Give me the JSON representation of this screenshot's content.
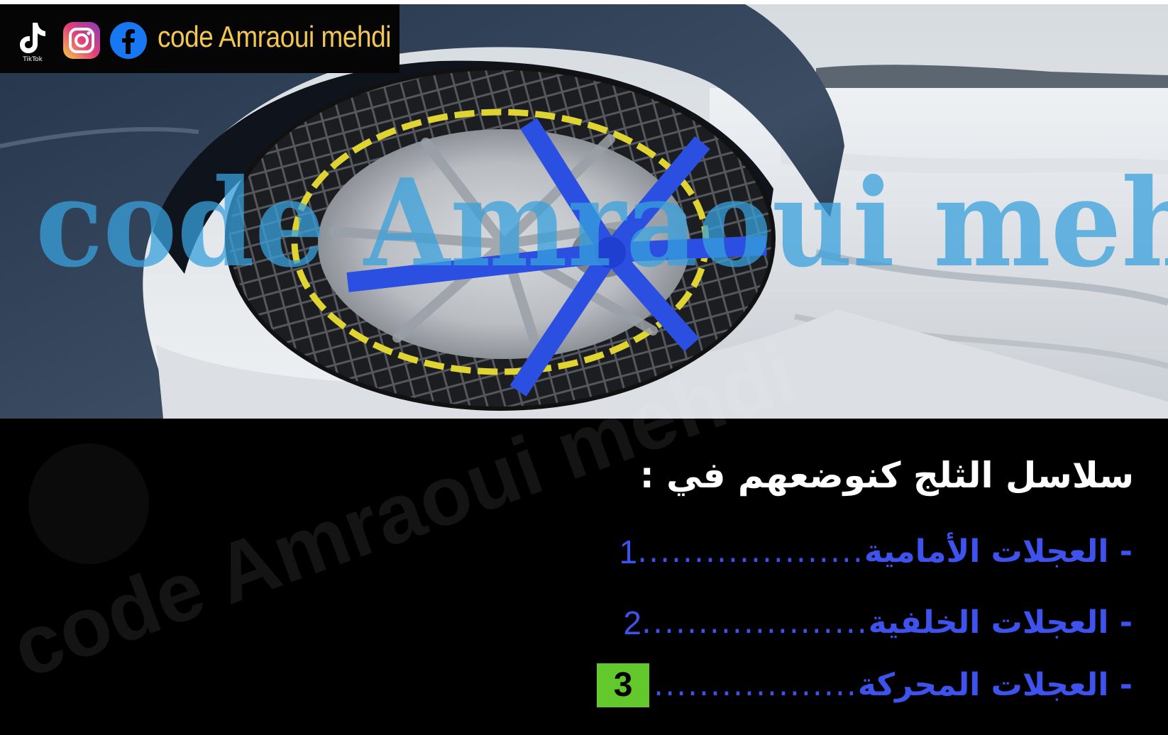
{
  "social": {
    "tiktok_label": "TikTok",
    "brand": "code Amraoui mehdi"
  },
  "watermark": {
    "overlay_text": "code Amraoui mehdi",
    "diagonal_text": "code Amraoui mehdi"
  },
  "question": {
    "title": "سلاسل الثلج كنوضعهم في :",
    "options": [
      {
        "text": "- العجلات الأمامية",
        "dots": "....................",
        "number": "1"
      },
      {
        "text": "- العجلات الخلفية",
        "dots": "....................",
        "number": "2"
      },
      {
        "text": "- العجلات المحركة",
        "dots": "..................",
        "number": "3"
      }
    ],
    "answer_color": "#63c82b"
  },
  "colors": {
    "option_text": "#3e52ee",
    "brand_text": "#f1c655",
    "watermark": "#38a0dc"
  }
}
